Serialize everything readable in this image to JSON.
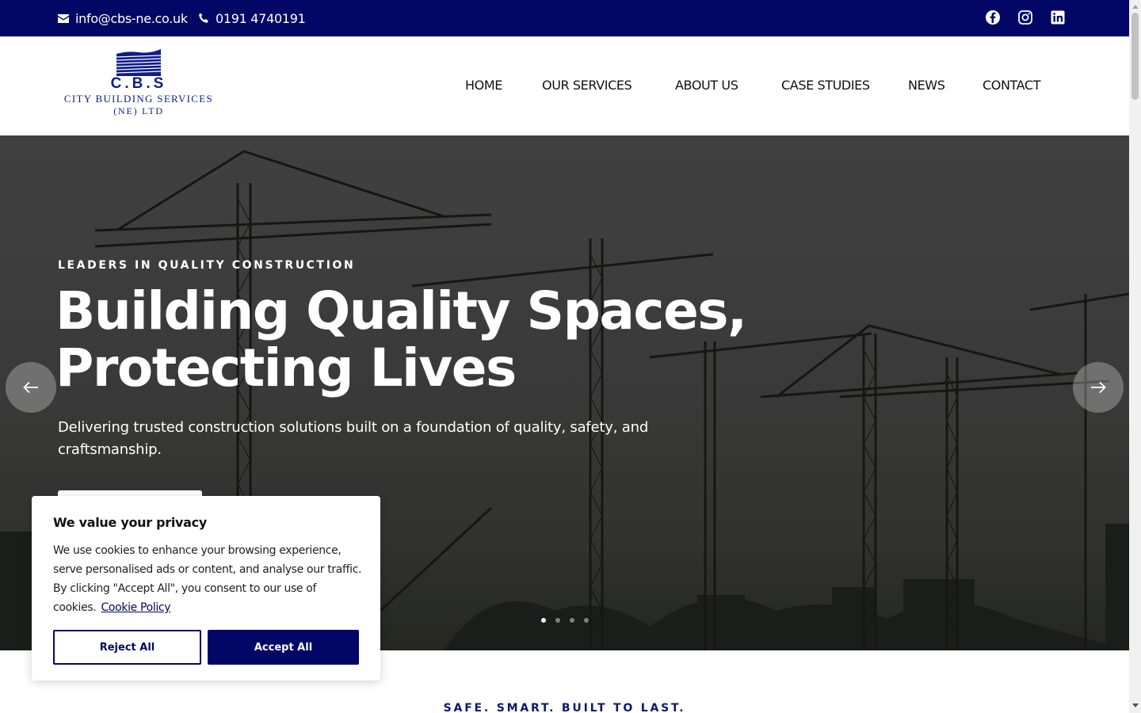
{
  "topbar": {
    "email": "info@cbs-ne.co.uk",
    "phone": "0191 4740191",
    "email_icon": "envelope-icon",
    "phone_icon": "phone-icon",
    "social": [
      "facebook-icon",
      "instagram-icon",
      "linkedin-icon"
    ],
    "bg_color": "#020766"
  },
  "logo": {
    "abbr": "C.B.S",
    "line1": "CITY BUILDING SERVICES",
    "line2": "(NE) LTD",
    "color": "#0f1e8a"
  },
  "nav": {
    "items": [
      "HOME",
      "OUR SERVICES",
      "ABOUT US",
      "CASE STUDIES",
      "NEWS",
      "CONTACT"
    ]
  },
  "hero": {
    "eyebrow": "LEADERS IN QUALITY CONSTRUCTION",
    "headline_line1": "Building Quality Spaces,",
    "headline_line2": "Protecting Lives",
    "subline": "Delivering trusted construction solutions built on a foundation of quality, safety, and craftsmanship.",
    "prev_icon": "arrow-left-icon",
    "next_icon": "arrow-right-icon",
    "slide_count": 4,
    "active_slide": 1
  },
  "section": {
    "tagline": "SAFE. SMART. BUILT TO LAST."
  },
  "cookie": {
    "title": "We value your privacy",
    "message": "We use cookies to enhance your browsing experience, serve personalised ads or content, and analyse our traffic. By clicking \"Accept All\", you consent to our use of cookies.",
    "policy_link": "Cookie Policy",
    "reject_label": "Reject All",
    "accept_label": "Accept All"
  }
}
